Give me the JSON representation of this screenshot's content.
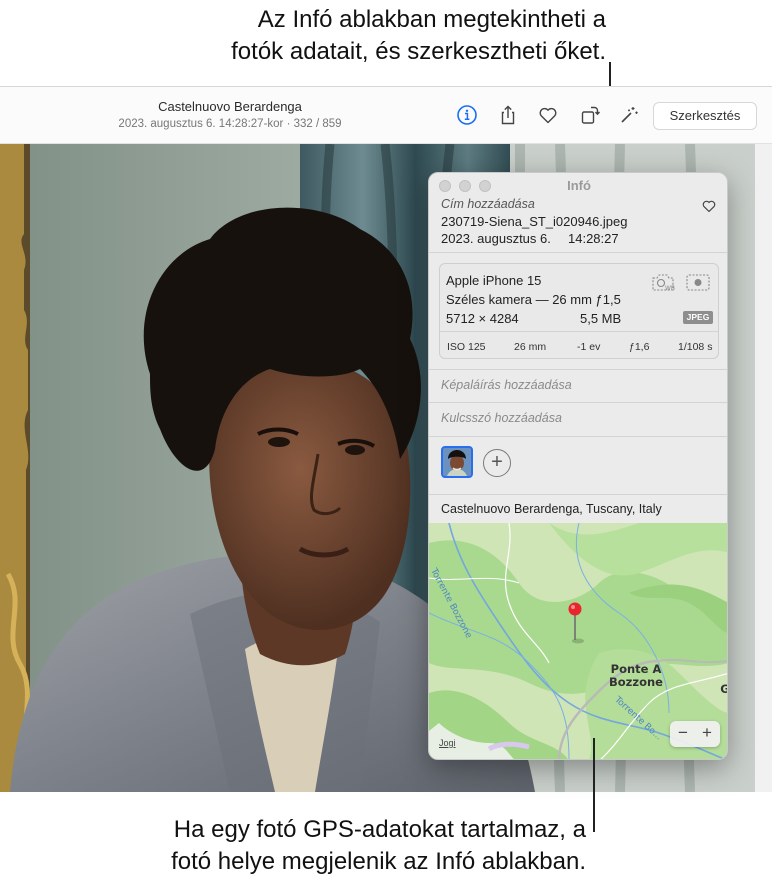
{
  "callouts": {
    "top_line1": "Az Infó ablakban megtekintheti a",
    "top_line2": "fotók adatait, és szerkesztheti őket.",
    "bottom_line1": "Ha egy fotó GPS-adatokat tartalmaz, a",
    "bottom_line2": "fotó helye megjelenik az Infó ablakban."
  },
  "toolbar": {
    "title": "Castelnuovo Berardenga",
    "subtitle": "2023. augusztus 6. 14:28:27-kor  ·  332 / 859",
    "edit_label": "Szerkesztés",
    "icons": [
      "info-icon",
      "share-icon",
      "heart-icon",
      "rotate-icon",
      "magic-wand-icon"
    ],
    "accent": "#1a6ff0"
  },
  "info_panel": {
    "title": "Infó",
    "add_title_placeholder": "Cím hozzáadása",
    "filename": "230719-Siena_ST_i020946.jpeg",
    "date": "2023. augusztus 6.",
    "time": "14:28:27",
    "camera": {
      "model": "Apple iPhone 15",
      "lens": "Széles kamera — 26 mm ƒ1,5",
      "resolution": "5712 × 4284",
      "size": "5,5 MB",
      "format": "JPEG",
      "exif": {
        "iso": "ISO 125",
        "focal": "26 mm",
        "ev": "-1 ev",
        "aperture": "ƒ1,6",
        "shutter": "1/108 s"
      }
    },
    "caption_placeholder": "Képaláírás hozzáadása",
    "keyword_placeholder": "Kulcsszó hozzáadása",
    "add_face_label": "+",
    "location": "Castelnuovo Berardenga, Tuscany, Italy",
    "map": {
      "place_label_line1": "Ponte A",
      "place_label_line2": "Bozzone",
      "edge_label": "G",
      "river_label_1": "Torrente Bozzone",
      "river_label_2": "Torrente Bo...",
      "legal_label": "Jogi",
      "zoom_out_label": "−",
      "zoom_in_label": "+",
      "pin_color": "#e8262d"
    }
  }
}
